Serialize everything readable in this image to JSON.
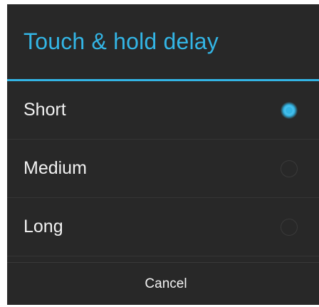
{
  "dialog": {
    "title": "Touch & hold delay",
    "options": [
      {
        "label": "Short",
        "selected": true
      },
      {
        "label": "Medium",
        "selected": false
      },
      {
        "label": "Long",
        "selected": false
      }
    ],
    "cancel_label": "Cancel"
  },
  "colors": {
    "accent": "#33b5e5",
    "background": "#282828",
    "text": "#f2f2f2"
  },
  "icons": {
    "radio_checked": "radio-checked-icon",
    "radio_unchecked": "radio-unchecked-icon"
  }
}
